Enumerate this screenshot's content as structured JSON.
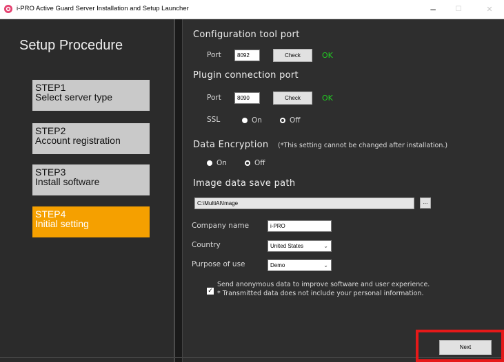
{
  "window": {
    "title": "i-PRO Active Guard Server Installation and Setup Launcher",
    "minimize": "−",
    "maximize": "☐",
    "close": "✕"
  },
  "sidebar": {
    "title": "Setup Procedure",
    "steps": [
      {
        "label": "STEP1",
        "desc": "Select server type",
        "active": false
      },
      {
        "label": "STEP2",
        "desc": "Account registration",
        "active": false
      },
      {
        "label": "STEP3",
        "desc": "Install software",
        "active": false
      },
      {
        "label": "STEP4",
        "desc": "Initial setting",
        "active": true
      }
    ]
  },
  "config_port": {
    "heading": "Configuration tool port",
    "port_label": "Port",
    "port_value": "8092",
    "check_label": "Check",
    "status": "OK"
  },
  "plugin_port": {
    "heading": "Plugin connection port",
    "port_label": "Port",
    "port_value": "8090",
    "check_label": "Check",
    "status": "OK",
    "ssl_label": "SSL",
    "ssl_on": "On",
    "ssl_off": "Off",
    "ssl_selected": "On"
  },
  "encryption": {
    "heading": "Data Encryption",
    "note": "(*This setting cannot be changed after installation.)",
    "on": "On",
    "off": "Off",
    "selected": "On"
  },
  "image_path": {
    "heading": "Image data save path",
    "value": "C:\\MultiAI\\Image",
    "browse_label": "..."
  },
  "company": {
    "label": "Company name",
    "value": "i-PRO"
  },
  "country": {
    "label": "Country",
    "value": "United States"
  },
  "purpose": {
    "label": "Purpose of use",
    "value": "Demo"
  },
  "consent": {
    "checked": true,
    "line1": "Send anonymous data to improve software and user experience.",
    "line2": "* Transmitted data does not include your personal information."
  },
  "footer": {
    "next_label": "Next"
  },
  "colors": {
    "accent": "#f5a000",
    "ok": "#22cc22",
    "highlight": "#e61919"
  }
}
